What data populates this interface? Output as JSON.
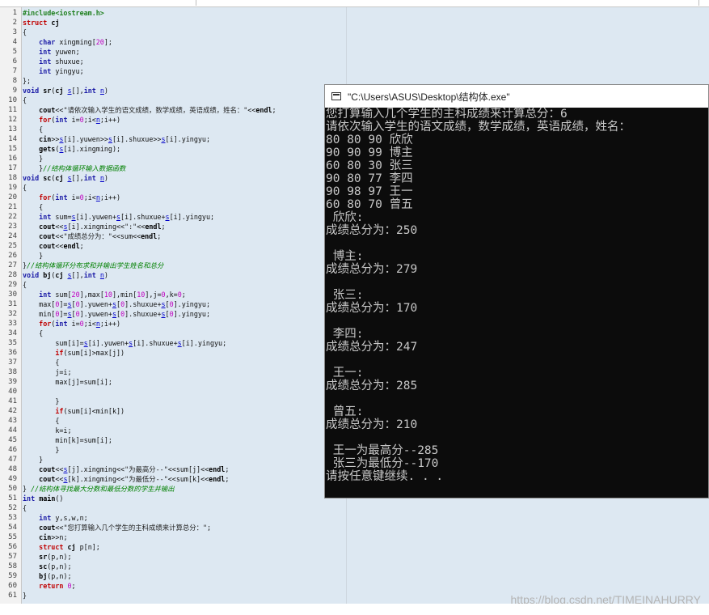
{
  "editor": {
    "lines": [
      [
        [
          "pp",
          "#include<iostream.h>"
        ]
      ],
      [
        [
          "kw",
          "struct"
        ],
        [
          "t",
          " "
        ],
        [
          "fn",
          "cj"
        ]
      ],
      [
        [
          "t",
          "{"
        ]
      ],
      [
        [
          "t",
          "    "
        ],
        [
          "ty",
          "char"
        ],
        [
          "t",
          " xingming["
        ],
        [
          "nm",
          "20"
        ],
        [
          "t",
          "];"
        ]
      ],
      [
        [
          "t",
          "    "
        ],
        [
          "ty",
          "int"
        ],
        [
          "t",
          " yuwen;"
        ]
      ],
      [
        [
          "t",
          "    "
        ],
        [
          "ty",
          "int"
        ],
        [
          "t",
          " shuxue;"
        ]
      ],
      [
        [
          "t",
          "    "
        ],
        [
          "ty",
          "int"
        ],
        [
          "t",
          " yingyu;"
        ]
      ],
      [
        [
          "t",
          "};"
        ]
      ],
      [
        [
          "ty",
          "void"
        ],
        [
          "t",
          " "
        ],
        [
          "fn",
          "sr"
        ],
        [
          "t",
          "("
        ],
        [
          "fn",
          "cj"
        ],
        [
          "t",
          " "
        ],
        [
          "va",
          "s"
        ],
        [
          "t",
          "[],"
        ],
        [
          "ty",
          "int"
        ],
        [
          "t",
          " "
        ],
        [
          "va",
          "n"
        ],
        [
          "t",
          ")"
        ]
      ],
      [
        [
          "t",
          "{"
        ]
      ],
      [
        [
          "t",
          "    "
        ],
        [
          "fn",
          "cout"
        ],
        [
          "t",
          "<<"
        ],
        [
          "st",
          "\"请依次输入学生的语文成绩，数学成绩，英语成绩，姓名：\""
        ],
        [
          "t",
          "<<"
        ],
        [
          "fn",
          "endl"
        ],
        [
          "t",
          ";"
        ]
      ],
      [
        [
          "t",
          "    "
        ],
        [
          "kw",
          "for"
        ],
        [
          "t",
          "("
        ],
        [
          "ty",
          "int"
        ],
        [
          "t",
          " i="
        ],
        [
          "nm",
          "0"
        ],
        [
          "t",
          ";i<"
        ],
        [
          "va",
          "n"
        ],
        [
          "t",
          ";i++)"
        ]
      ],
      [
        [
          "t",
          "    {"
        ]
      ],
      [
        [
          "t",
          "    "
        ],
        [
          "fn",
          "cin"
        ],
        [
          "t",
          ">>"
        ],
        [
          "va",
          "s"
        ],
        [
          "t",
          "[i].yuwen>>"
        ],
        [
          "va",
          "s"
        ],
        [
          "t",
          "[i].shuxue>>"
        ],
        [
          "va",
          "s"
        ],
        [
          "t",
          "[i].yingyu;"
        ]
      ],
      [
        [
          "t",
          "    "
        ],
        [
          "fn",
          "gets"
        ],
        [
          "t",
          "("
        ],
        [
          "va",
          "s"
        ],
        [
          "t",
          "[i].xingming);"
        ]
      ],
      [
        [
          "t",
          "    }"
        ]
      ],
      [
        [
          "t",
          "    }"
        ],
        [
          "cm",
          "//结构体循环输入数据函数"
        ]
      ],
      [
        [
          "ty",
          "void"
        ],
        [
          "t",
          " "
        ],
        [
          "fn",
          "sc"
        ],
        [
          "t",
          "("
        ],
        [
          "fn",
          "cj"
        ],
        [
          "t",
          " "
        ],
        [
          "va",
          "s"
        ],
        [
          "t",
          "[],"
        ],
        [
          "ty",
          "int"
        ],
        [
          "t",
          " "
        ],
        [
          "va",
          "n"
        ],
        [
          "t",
          ")"
        ]
      ],
      [
        [
          "t",
          "{"
        ]
      ],
      [
        [
          "t",
          "    "
        ],
        [
          "kw",
          "for"
        ],
        [
          "t",
          "("
        ],
        [
          "ty",
          "int"
        ],
        [
          "t",
          " i="
        ],
        [
          "nm",
          "0"
        ],
        [
          "t",
          ";i<"
        ],
        [
          "va",
          "n"
        ],
        [
          "t",
          ";i++)"
        ]
      ],
      [
        [
          "t",
          "    {"
        ]
      ],
      [
        [
          "t",
          "    "
        ],
        [
          "ty",
          "int"
        ],
        [
          "t",
          " sum="
        ],
        [
          "va",
          "s"
        ],
        [
          "t",
          "[i].yuwen+"
        ],
        [
          "va",
          "s"
        ],
        [
          "t",
          "[i].shuxue+"
        ],
        [
          "va",
          "s"
        ],
        [
          "t",
          "[i].yingyu;"
        ]
      ],
      [
        [
          "t",
          "    "
        ],
        [
          "fn",
          "cout"
        ],
        [
          "t",
          "<<"
        ],
        [
          "va",
          "s"
        ],
        [
          "t",
          "[i].xingming<<"
        ],
        [
          "st",
          "\":\""
        ],
        [
          "t",
          "<<"
        ],
        [
          "fn",
          "endl"
        ],
        [
          "t",
          ";"
        ]
      ],
      [
        [
          "t",
          "    "
        ],
        [
          "fn",
          "cout"
        ],
        [
          "t",
          "<<"
        ],
        [
          "st",
          "\"成绩总分为：\""
        ],
        [
          "t",
          "<<sum<<"
        ],
        [
          "fn",
          "endl"
        ],
        [
          "t",
          ";"
        ]
      ],
      [
        [
          "t",
          "    "
        ],
        [
          "fn",
          "cout"
        ],
        [
          "t",
          "<<"
        ],
        [
          "fn",
          "endl"
        ],
        [
          "t",
          ";"
        ]
      ],
      [
        [
          "t",
          "    }"
        ]
      ],
      [
        [
          "t",
          "}"
        ],
        [
          "cm",
          "//结构体循环分布求和并输出学生姓名和总分"
        ]
      ],
      [
        [
          "ty",
          "void"
        ],
        [
          "t",
          " "
        ],
        [
          "fn",
          "bj"
        ],
        [
          "t",
          "("
        ],
        [
          "fn",
          "cj"
        ],
        [
          "t",
          " "
        ],
        [
          "va",
          "s"
        ],
        [
          "t",
          "[],"
        ],
        [
          "ty",
          "int"
        ],
        [
          "t",
          " "
        ],
        [
          "va",
          "n"
        ],
        [
          "t",
          ")"
        ]
      ],
      [
        [
          "t",
          "{"
        ]
      ],
      [
        [
          "t",
          "    "
        ],
        [
          "ty",
          "int"
        ],
        [
          "t",
          " sum["
        ],
        [
          "nm",
          "20"
        ],
        [
          "t",
          "],max["
        ],
        [
          "nm",
          "10"
        ],
        [
          "t",
          "],min["
        ],
        [
          "nm",
          "10"
        ],
        [
          "t",
          "],j="
        ],
        [
          "nm",
          "0"
        ],
        [
          "t",
          ",k="
        ],
        [
          "nm",
          "0"
        ],
        [
          "t",
          ";"
        ]
      ],
      [
        [
          "t",
          "    max["
        ],
        [
          "nm",
          "0"
        ],
        [
          "t",
          "]="
        ],
        [
          "va",
          "s"
        ],
        [
          "t",
          "["
        ],
        [
          "nm",
          "0"
        ],
        [
          "t",
          "].yuwen+"
        ],
        [
          "va",
          "s"
        ],
        [
          "t",
          "["
        ],
        [
          "nm",
          "0"
        ],
        [
          "t",
          "].shuxue+"
        ],
        [
          "va",
          "s"
        ],
        [
          "t",
          "["
        ],
        [
          "nm",
          "0"
        ],
        [
          "t",
          "].yingyu;"
        ]
      ],
      [
        [
          "t",
          "    min["
        ],
        [
          "nm",
          "0"
        ],
        [
          "t",
          "]="
        ],
        [
          "va",
          "s"
        ],
        [
          "t",
          "["
        ],
        [
          "nm",
          "0"
        ],
        [
          "t",
          "].yuwen+"
        ],
        [
          "va",
          "s"
        ],
        [
          "t",
          "["
        ],
        [
          "nm",
          "0"
        ],
        [
          "t",
          "].shuxue+"
        ],
        [
          "va",
          "s"
        ],
        [
          "t",
          "["
        ],
        [
          "nm",
          "0"
        ],
        [
          "t",
          "].yingyu;"
        ]
      ],
      [
        [
          "t",
          "    "
        ],
        [
          "kw",
          "for"
        ],
        [
          "t",
          "("
        ],
        [
          "ty",
          "int"
        ],
        [
          "t",
          " i="
        ],
        [
          "nm",
          "0"
        ],
        [
          "t",
          ";i<"
        ],
        [
          "va",
          "n"
        ],
        [
          "t",
          ";i++)"
        ]
      ],
      [
        [
          "t",
          "    {"
        ]
      ],
      [
        [
          "t",
          "        sum[i]="
        ],
        [
          "va",
          "s"
        ],
        [
          "t",
          "[i].yuwen+"
        ],
        [
          "va",
          "s"
        ],
        [
          "t",
          "[i].shuxue+"
        ],
        [
          "va",
          "s"
        ],
        [
          "t",
          "[i].yingyu;"
        ]
      ],
      [
        [
          "t",
          "        "
        ],
        [
          "kw",
          "if"
        ],
        [
          "t",
          "(sum[i]>max[j])"
        ]
      ],
      [
        [
          "t",
          "        {"
        ]
      ],
      [
        [
          "t",
          "        j=i;"
        ]
      ],
      [
        [
          "t",
          "        max[j]=sum[i];"
        ]
      ],
      [
        [
          "t",
          ""
        ]
      ],
      [
        [
          "t",
          "        }"
        ]
      ],
      [
        [
          "t",
          "        "
        ],
        [
          "kw",
          "if"
        ],
        [
          "t",
          "(sum[i]<min[k])"
        ]
      ],
      [
        [
          "t",
          "        {"
        ]
      ],
      [
        [
          "t",
          "        k=i;"
        ]
      ],
      [
        [
          "t",
          "        min[k]=sum[i];"
        ]
      ],
      [
        [
          "t",
          "        }"
        ]
      ],
      [
        [
          "t",
          "    }"
        ]
      ],
      [
        [
          "t",
          "    "
        ],
        [
          "fn",
          "cout"
        ],
        [
          "t",
          "<<"
        ],
        [
          "va",
          "s"
        ],
        [
          "t",
          "[j].xingming<<"
        ],
        [
          "st",
          "\"为最高分--\""
        ],
        [
          "t",
          "<<sum[j]<<"
        ],
        [
          "fn",
          "endl"
        ],
        [
          "t",
          ";"
        ]
      ],
      [
        [
          "t",
          "    "
        ],
        [
          "fn",
          "cout"
        ],
        [
          "t",
          "<<"
        ],
        [
          "va",
          "s"
        ],
        [
          "t",
          "[k].xingming<<"
        ],
        [
          "st",
          "\"为最低分--\""
        ],
        [
          "t",
          "<<sum[k]<<"
        ],
        [
          "fn",
          "endl"
        ],
        [
          "t",
          ";"
        ]
      ],
      [
        [
          "t",
          "} "
        ],
        [
          "cm",
          "//结构体寻找最大分数和最低分数的学生并输出"
        ]
      ],
      [
        [
          "ty",
          "int"
        ],
        [
          "t",
          " "
        ],
        [
          "fn",
          "main"
        ],
        [
          "t",
          "()"
        ]
      ],
      [
        [
          "t",
          "{"
        ]
      ],
      [
        [
          "t",
          "    "
        ],
        [
          "ty",
          "int"
        ],
        [
          "t",
          " y,s,w,n;"
        ]
      ],
      [
        [
          "t",
          "    "
        ],
        [
          "fn",
          "cout"
        ],
        [
          "t",
          "<<"
        ],
        [
          "st",
          "\"您打算输入几个学生的主科成绩来计算总分：\""
        ],
        [
          "t",
          ";"
        ]
      ],
      [
        [
          "t",
          "    "
        ],
        [
          "fn",
          "cin"
        ],
        [
          "t",
          ">>n;"
        ]
      ],
      [
        [
          "t",
          "    "
        ],
        [
          "kw",
          "struct"
        ],
        [
          "t",
          " "
        ],
        [
          "fn",
          "cj"
        ],
        [
          "t",
          " p[n];"
        ]
      ],
      [
        [
          "t",
          "    "
        ],
        [
          "fn",
          "sr"
        ],
        [
          "t",
          "(p,n);"
        ]
      ],
      [
        [
          "t",
          "    "
        ],
        [
          "fn",
          "sc"
        ],
        [
          "t",
          "(p,n);"
        ]
      ],
      [
        [
          "t",
          "    "
        ],
        [
          "fn",
          "bj"
        ],
        [
          "t",
          "(p,n);"
        ]
      ],
      [
        [
          "t",
          "    "
        ],
        [
          "kw",
          "return"
        ],
        [
          "t",
          " "
        ],
        [
          "nm",
          "0"
        ],
        [
          "t",
          ";"
        ]
      ],
      [
        [
          "t",
          "}"
        ]
      ]
    ]
  },
  "console": {
    "title": "\"C:\\Users\\ASUS\\Desktop\\结构体.exe\"",
    "lines": [
      "您打算输入几个学生的主科成绩来计算总分：6",
      "请依次输入学生的语文成绩，数学成绩，英语成绩，姓名：",
      "80 80 90 欣欣",
      "90 90 99 博主",
      "60 80 30 张三",
      "90 80 77 李四",
      "90 98 97 王一",
      "60 80 70 曾五",
      " 欣欣:",
      "成绩总分为：250",
      "",
      " 博主:",
      "成绩总分为：279",
      "",
      " 张三:",
      "成绩总分为：170",
      "",
      " 李四:",
      "成绩总分为：247",
      "",
      " 王一:",
      "成绩总分为：285",
      "",
      " 曾五:",
      "成绩总分为：210",
      "",
      " 王一为最高分--285",
      " 张三为最低分--170",
      "请按任意键继续. . ."
    ]
  },
  "watermark": "https://blog.csdn.net/TIMEINAHURRY"
}
